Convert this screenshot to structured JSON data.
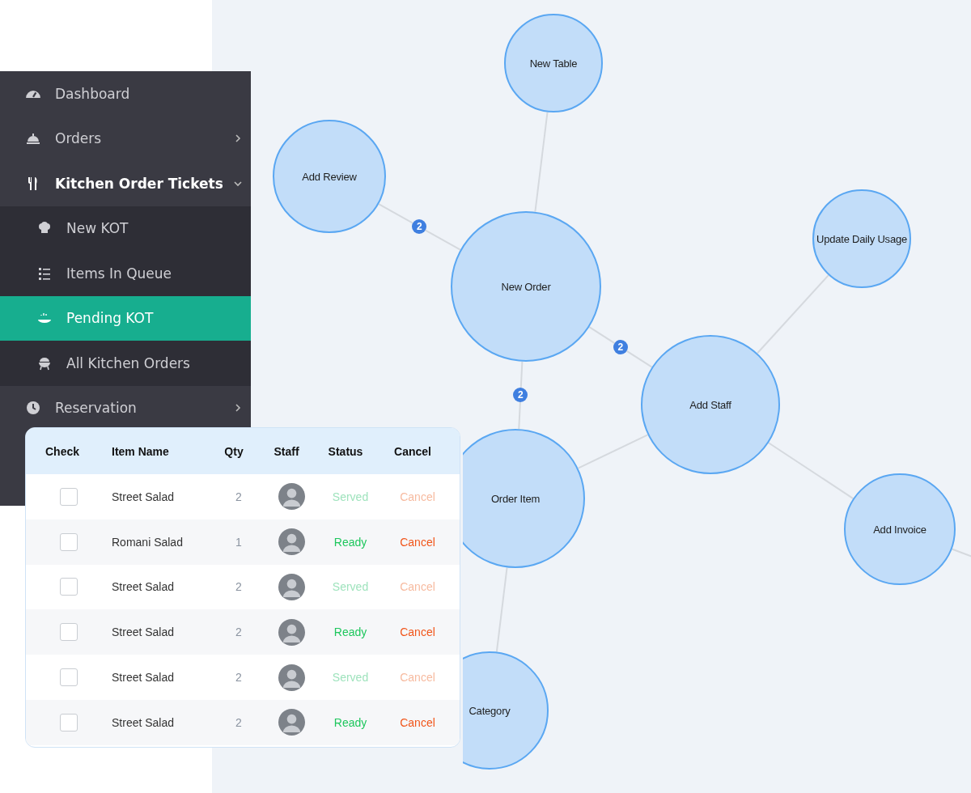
{
  "sidebar": {
    "items": [
      {
        "label": "Dashboard",
        "selected": false
      },
      {
        "label": "Orders",
        "selected": false,
        "expanded": false
      },
      {
        "label": "Kitchen Order Tickets",
        "selected": false,
        "expanded": true,
        "children": [
          {
            "label": "New KOT",
            "selected": false
          },
          {
            "label": "Items In Queue",
            "selected": false
          },
          {
            "label": "Pending KOT",
            "selected": true
          },
          {
            "label": "All Kitchen Orders",
            "selected": false
          }
        ]
      },
      {
        "label": "Reservation",
        "selected": false,
        "expanded": false
      }
    ]
  },
  "table": {
    "columns": [
      "Check",
      "Item Name",
      "Qty",
      "Staff",
      "Status",
      "Cancel"
    ],
    "rows": [
      {
        "checked": false,
        "item": "Street Salad",
        "qty": "2",
        "status": "Served",
        "cancel": "Cancel",
        "disabled": true
      },
      {
        "checked": false,
        "item": "Romani Salad",
        "qty": "1",
        "status": "Ready",
        "cancel": "Cancel",
        "disabled": false
      },
      {
        "checked": false,
        "item": "Street Salad",
        "qty": "2",
        "status": "Served",
        "cancel": "Cancel",
        "disabled": true
      },
      {
        "checked": false,
        "item": "Street Salad",
        "qty": "2",
        "status": "Ready",
        "cancel": "Cancel",
        "disabled": false
      },
      {
        "checked": false,
        "item": "Street Salad",
        "qty": "2",
        "status": "Served",
        "cancel": "Cancel",
        "disabled": true
      },
      {
        "checked": false,
        "item": "Street Salad",
        "qty": "2",
        "status": "Ready",
        "cancel": "Cancel",
        "disabled": false
      }
    ]
  },
  "diagram": {
    "nodes": [
      "New Table",
      "Add Review",
      "Update Daily Usage",
      "New Order",
      "Add Staff",
      "Order Item",
      "Add Invoice",
      "Category"
    ],
    "badges": [
      "2",
      "2",
      "2"
    ]
  }
}
